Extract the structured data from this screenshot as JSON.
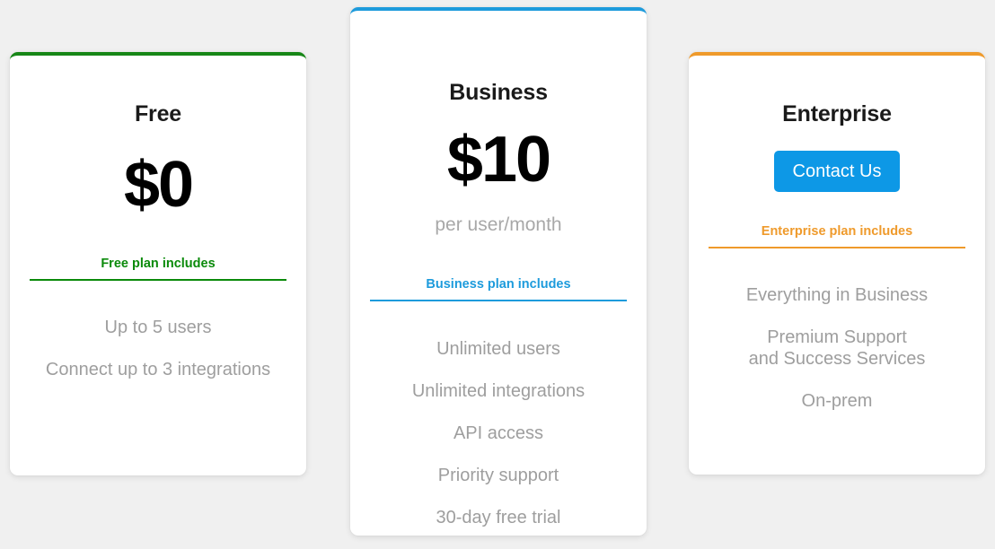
{
  "page": {
    "background_color": "#f0f0f0"
  },
  "plans": [
    {
      "id": "free",
      "name": "Free",
      "price": "$0",
      "period": null,
      "cta": null,
      "accent_color": "#178717",
      "includes_title": "Free plan includes",
      "features": [
        "Up to 5 users",
        "Connect up to 3 integrations"
      ]
    },
    {
      "id": "business",
      "name": "Business",
      "price": "$10",
      "period": "per user/month",
      "cta": null,
      "accent_color": "#1d9bdc",
      "includes_title": "Business plan includes",
      "features": [
        "Unlimited users",
        "Unlimited integrations",
        "API access",
        "Priority support",
        "30-day free trial"
      ]
    },
    {
      "id": "enterprise",
      "name": "Enterprise",
      "price": null,
      "period": null,
      "cta": "Contact Us",
      "cta_color": "#0d98e6",
      "accent_color": "#ef9a2b",
      "includes_title": "Enterprise plan includes",
      "features": [
        "Everything in Business",
        "Premium Support\nand Success Services",
        "On-prem"
      ]
    }
  ]
}
